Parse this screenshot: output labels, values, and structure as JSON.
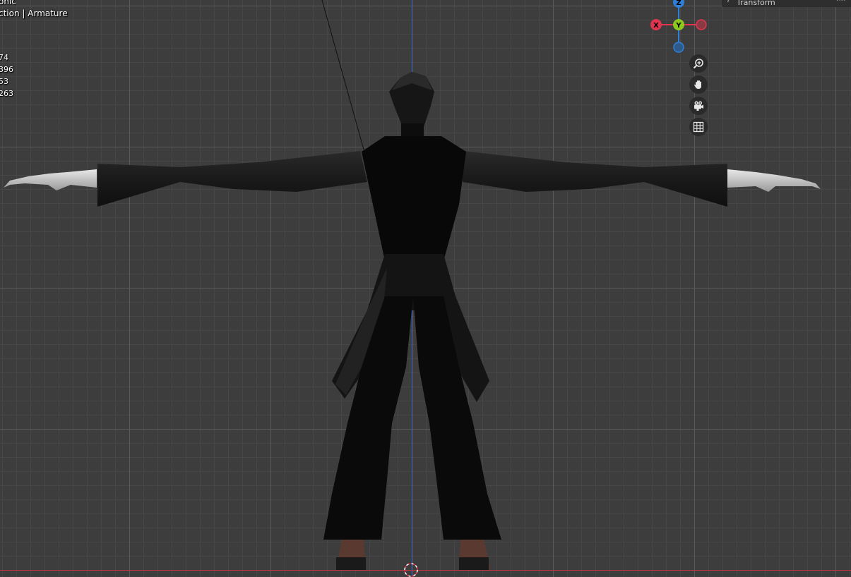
{
  "viewport": {
    "title": "onic",
    "collection": "ction | Armature",
    "stats": [
      "74",
      "396",
      "53",
      "263"
    ]
  },
  "gizmo": {
    "z_label": "Z",
    "y_label": "Y",
    "x_label": "X",
    "colors": {
      "x": "#e0354f",
      "y": "#8cc81e",
      "z": "#2f7fd9"
    }
  },
  "nav_buttons": [
    {
      "icon": "zoom-in-icon"
    },
    {
      "icon": "hand-pan-icon"
    },
    {
      "icon": "camera-icon"
    },
    {
      "icon": "grid-icon"
    }
  ],
  "sidebar": {
    "tab_label": "Transform"
  }
}
